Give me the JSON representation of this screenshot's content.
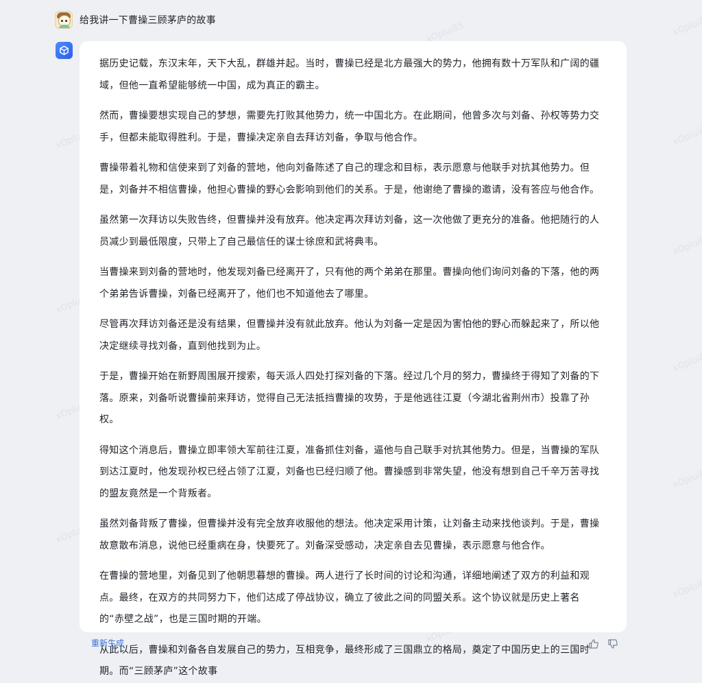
{
  "user_message": {
    "avatar_icon": "cartoon-avatar-icon",
    "text": "给我讲一下曹操三顾茅庐的故事"
  },
  "bot": {
    "avatar_icon": "cube-logo-icon",
    "accent_color": "#3b6fd8"
  },
  "answer": {
    "paragraphs": [
      "据历史记载，东汉末年，天下大乱，群雄并起。当时，曹操已经是北方最强大的势力，他拥有数十万军队和广阔的疆域，但他一直希望能够统一中国，成为真正的霸主。",
      "然而，曹操要想实现自己的梦想，需要先打败其他势力，统一中国北方。在此期间，他曾多次与刘备、孙权等势力交手，但都未能取得胜利。于是，曹操决定亲自去拜访刘备，争取与他合作。",
      "曹操带着礼物和信使来到了刘备的营地，他向刘备陈述了自己的理念和目标，表示愿意与他联手对抗其他势力。但是，刘备并不相信曹操，他担心曹操的野心会影响到他们的关系。于是，他谢绝了曹操的邀请，没有答应与他合作。",
      "虽然第一次拜访以失败告终，但曹操并没有放弃。他决定再次拜访刘备，这一次他做了更充分的准备。他把随行的人员减少到最低限度，只带上了自己最信任的谋士徐庶和武将典韦。",
      "当曹操来到刘备的营地时，他发现刘备已经离开了，只有他的两个弟弟在那里。曹操向他们询问刘备的下落，他的两个弟弟告诉曹操，刘备已经离开了，他们也不知道他去了哪里。",
      "尽管再次拜访刘备还是没有结果，但曹操并没有就此放弃。他认为刘备一定是因为害怕他的野心而躲起来了，所以他决定继续寻找刘备，直到他找到为止。",
      "于是，曹操开始在新野周围展开搜索，每天派人四处打探刘备的下落。经过几个月的努力，曹操终于得知了刘备的下落。原来，刘备听说曹操前来拜访，觉得自己无法抵挡曹操的攻势，于是他逃往江夏（今湖北省荆州市）投靠了孙权。",
      "得知这个消息后，曹操立即率领大军前往江夏，准备抓住刘备，逼他与自己联手对抗其他势力。但是，当曹操的军队到达江夏时，他发现孙权已经占领了江夏，刘备也已经归顺了他。曹操感到非常失望，他没有想到自己千辛万苦寻找的盟友竟然是一个背叛者。",
      "虽然刘备背叛了曹操，但曹操并没有完全放弃收服他的想法。他决定采用计策，让刘备主动来找他谈判。于是，曹操故意散布消息，说他已经重病在身，快要死了。刘备深受感动，决定亲自去见曹操，表示愿意与他合作。",
      "在曹操的营地里，刘备见到了他朝思暮想的曹操。两人进行了长时间的讨论和沟通，详细地阐述了双方的利益和观点。最终，在双方的共同努力下，他们达成了停战协议，确立了彼此之间的同盟关系。这个协议就是历史上著名的“赤壁之战”，也是三国时期的开端。",
      "从此以后，曹操和刘备各自发展自己的势力，互相竞争，最终形成了三国鼎立的格局，奠定了中国历史上的三国时期。而“三顾茅庐”这个故事"
    ]
  },
  "actions": {
    "regenerate_label": "重新生成",
    "like_icon": "thumbs-up-icon",
    "dislike_icon": "thumbs-down-icon"
  },
  "watermark": {
    "text": "xOplui85"
  }
}
